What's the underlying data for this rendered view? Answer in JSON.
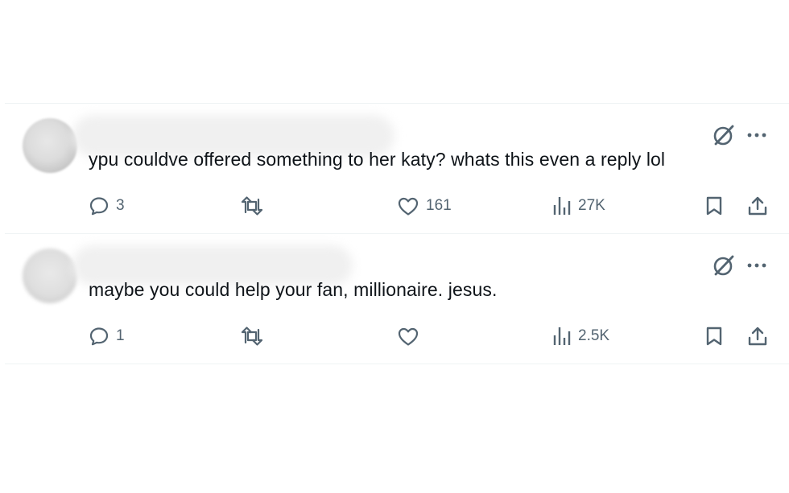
{
  "replies": [
    {
      "text": "ypu couldve offered something to her katy? whats this even a reply lol",
      "reply_count": "3",
      "retweet_count": "",
      "like_count": "161",
      "views": "27K"
    },
    {
      "text": "maybe you could help your fan, millionaire. jesus.",
      "reply_count": "1",
      "retweet_count": "",
      "like_count": "",
      "views": "2.5K"
    }
  ],
  "icons": {
    "reply": "reply-icon",
    "retweet": "retweet-icon",
    "like": "heart-icon",
    "views": "views-icon",
    "bookmark": "bookmark-icon",
    "share": "share-icon",
    "grok": "grok-icon",
    "more": "more-icon"
  },
  "colors": {
    "icon": "#536471",
    "text": "#0f1419",
    "divider": "#eff3f4"
  }
}
